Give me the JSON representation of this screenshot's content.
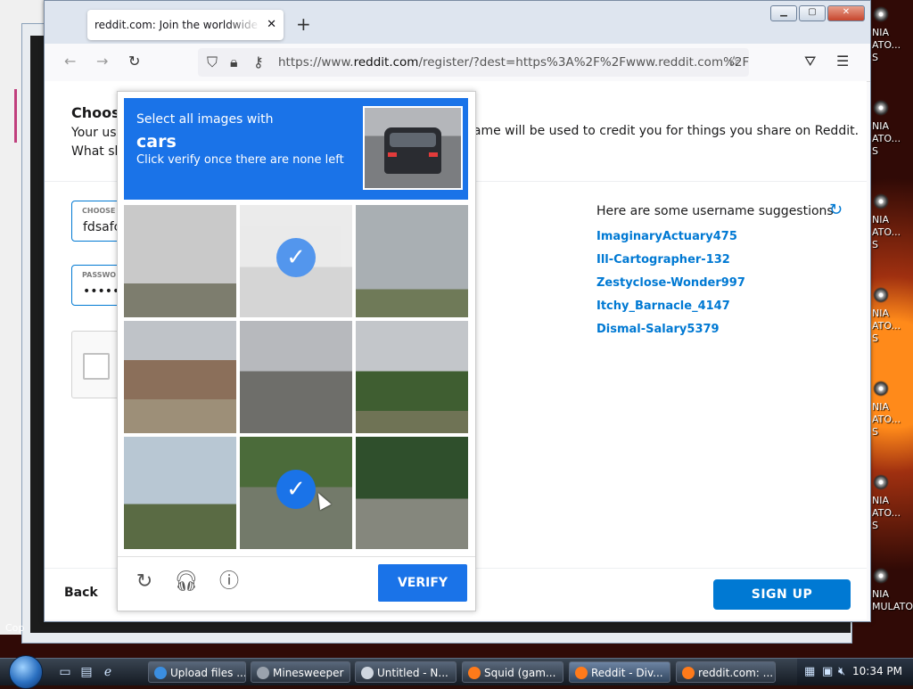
{
  "desktop": {
    "left_window_text": "Cop",
    "icons": [
      {
        "line1": "NIA",
        "line2": "ATO...",
        "line3": "S"
      },
      {
        "line1": "NIA",
        "line2": "ATO...",
        "line3": "S"
      },
      {
        "line1": "NIA",
        "line2": "ATO...",
        "line3": "S"
      },
      {
        "line1": "NIA",
        "line2": "ATO...",
        "line3": "S"
      },
      {
        "line1": "NIA",
        "line2": "ATO...",
        "line3": "S"
      },
      {
        "line1": "NIA",
        "line2": "ATO...",
        "line3": "S"
      },
      {
        "line1": "NIA",
        "line2": "MULATO...",
        "line3": ""
      }
    ]
  },
  "browser": {
    "tab_title": "reddit.com: Join the worldwide conversation",
    "tab_close": "✕",
    "new_tab": "+",
    "url_prefix": "https://www.",
    "url_domain": "reddit.com",
    "url_rest": "/register/?dest=https%3A%2F%2Fwww.reddit.com%2F",
    "window_buttons": {
      "minimize": "▁",
      "maximize": "▢",
      "close": "✕"
    }
  },
  "page": {
    "heading": "Choos",
    "desc_line1": "Your us",
    "desc_line2": "What sh",
    "desc_right": "name will be used to credit you for things you share on Reddit.",
    "username_label": "CHOOSE",
    "username_value": "fdsafc",
    "password_label": "PASSWO",
    "password_value": "•••••",
    "suggestions_title": "Here are some username suggestions",
    "suggestions": [
      "ImaginaryActuary475",
      "Ill-Cartographer-132",
      "Zestyclose-Wonder997",
      "Itchy_Barnacle_4147",
      "Dismal-Salary5379"
    ],
    "back_label": "Back",
    "signup_label": "SIGN UP"
  },
  "recaptcha": {
    "line1": "Select all images with",
    "target": "cars",
    "line3": "Click verify once there are none left",
    "verify_label": "VERIFY",
    "selected_tiles": [
      1,
      7
    ],
    "check_glyph": "✓"
  },
  "taskbar": {
    "tasks": [
      {
        "label": "Upload files ...",
        "color": "#3b8ee0"
      },
      {
        "label": "Minesweeper",
        "color": "#9aa2ad"
      },
      {
        "label": "Untitled - N...",
        "color": "#cfd6df"
      },
      {
        "label": "Squid (gam...",
        "color": "#ff7a1a"
      },
      {
        "label": "Reddit - Div...",
        "color": "#ff7a1a"
      },
      {
        "label": "reddit.com: ...",
        "color": "#ff7a1a"
      }
    ],
    "clock": "10:34 PM"
  }
}
